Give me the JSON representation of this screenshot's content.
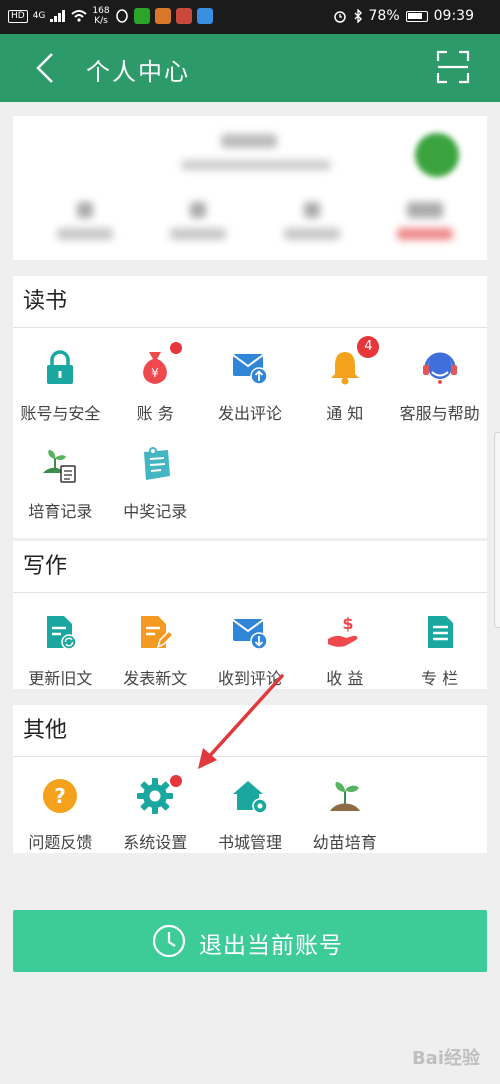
{
  "status_bar": {
    "hd": "HD",
    "net": "4G",
    "speed_value": "168",
    "speed_unit": "K/s",
    "battery": "78%",
    "time": "09:39"
  },
  "header": {
    "title": "个人中心",
    "color": "#2d9a6a"
  },
  "sections": {
    "reading": {
      "title": "读书",
      "items": [
        {
          "label": "账号与安全",
          "icon": "lock-icon"
        },
        {
          "label": "账  务",
          "icon": "money-bag-icon",
          "dot": true
        },
        {
          "label": "发出评论",
          "icon": "mail-send-icon"
        },
        {
          "label": "通  知",
          "icon": "bell-icon",
          "badge": "4"
        },
        {
          "label": "客服与帮助",
          "icon": "headset-icon"
        },
        {
          "label": "培育记录",
          "icon": "seedling-record-icon"
        },
        {
          "label": "中奖记录",
          "icon": "prize-record-icon"
        }
      ]
    },
    "writing": {
      "title": "写作",
      "items": [
        {
          "label": "更新旧文",
          "icon": "update-doc-icon"
        },
        {
          "label": "发表新文",
          "icon": "new-doc-icon"
        },
        {
          "label": "收到评论",
          "icon": "mail-receive-icon"
        },
        {
          "label": "收  益",
          "icon": "income-icon"
        },
        {
          "label": "专  栏",
          "icon": "column-icon"
        }
      ]
    },
    "other": {
      "title": "其他",
      "items": [
        {
          "label": "问题反馈",
          "icon": "question-icon"
        },
        {
          "label": "系统设置",
          "icon": "gear-icon",
          "dot": true
        },
        {
          "label": "书城管理",
          "icon": "bookstore-settings-icon"
        },
        {
          "label": "幼苗培育",
          "icon": "sprout-icon"
        }
      ]
    }
  },
  "logout": {
    "label": "退出当前账号",
    "color": "#3dcc99"
  },
  "watermark": "Bai经验"
}
